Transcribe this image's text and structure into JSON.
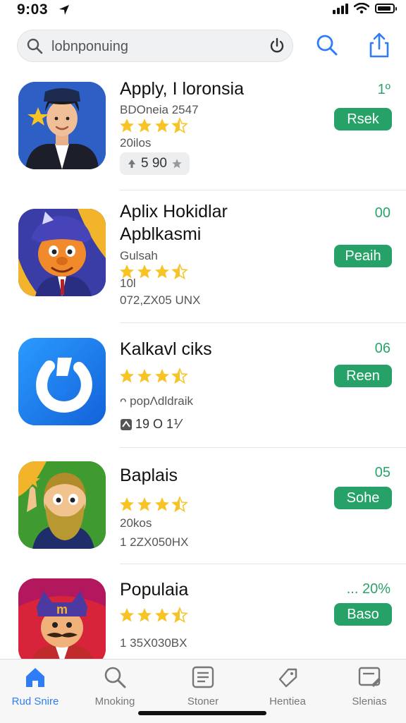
{
  "status_bar": {
    "time": "9:03"
  },
  "search": {
    "placeholder": "lobnponuing"
  },
  "apps": [
    {
      "name": "Apply, I loronsia",
      "subtitle": "BDOneia 2547",
      "reviews": "20ilos",
      "chip": "5 90",
      "rank": "1º",
      "button": "Rsek",
      "rating": 3.5
    },
    {
      "name": "Aplix Hokidlar",
      "name_line2": "Apblkasmi",
      "subtitle": "Gulsah",
      "reviews": "10l",
      "size": "072,ZX05 UNX",
      "rank": "00",
      "button": "Peaih",
      "rating": 3.5
    },
    {
      "name": "Kalkavl ciks",
      "subtitle": "ᴖ popΛdldraik",
      "chip": "19 O 1⅟",
      "rank": "06",
      "button": "Reen",
      "rating": 3.5
    },
    {
      "name": "Baplais",
      "reviews": "20kos",
      "size": "1 2ZX050HX",
      "rank": "05",
      "button": "Sohe",
      "rating": 3.5
    },
    {
      "name": "Populaia",
      "size": "1 35X030BX",
      "rank": "... 20%",
      "button": "Baso",
      "rating": 3.5
    }
  ],
  "tabs": [
    {
      "label": "Rud Snire",
      "icon": "home-icon"
    },
    {
      "label": "Mnoking",
      "icon": "search-icon"
    },
    {
      "label": "Stoner",
      "icon": "document-icon"
    },
    {
      "label": "Hentiea",
      "icon": "tag-icon"
    },
    {
      "label": "Slenias",
      "icon": "edit-icon"
    }
  ],
  "colors": {
    "accent_green": "#26a269",
    "accent_blue": "#2e7cf6",
    "star": "#f7c325"
  }
}
